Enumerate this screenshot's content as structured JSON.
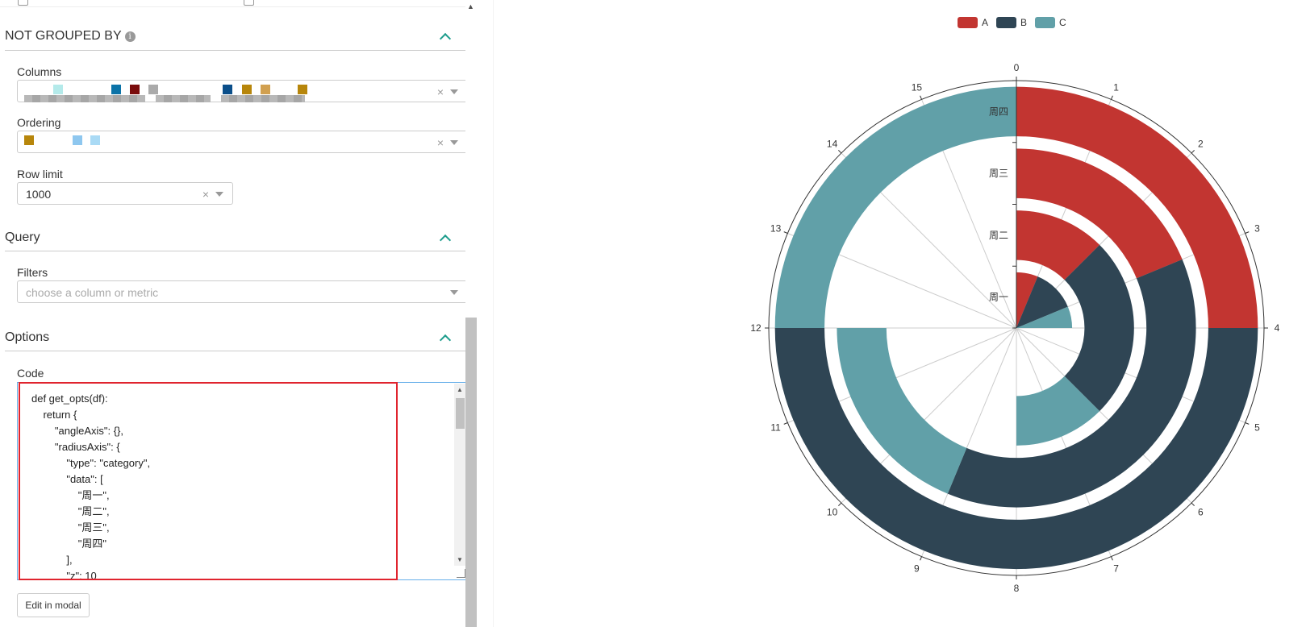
{
  "sections": {
    "not_grouped_by": {
      "title": "NOT GROUPED BY",
      "info_icon": "info-icon"
    },
    "columns": {
      "label": "Columns"
    },
    "ordering": {
      "label": "Ordering"
    },
    "row_limit": {
      "label": "Row limit",
      "value": "1000"
    },
    "query": {
      "title": "Query"
    },
    "filters": {
      "label": "Filters",
      "placeholder": "choose a column or metric"
    },
    "options": {
      "title": "Options"
    },
    "code": {
      "label": "Code",
      "text": "def get_opts(df):\n    return {\n        \"angleAxis\": {},\n        \"radiusAxis\": {\n            \"type\": \"category\",\n            \"data\": [\n                \"周一\",\n                \"周二\",\n                \"周三\",\n                \"周四\"\n            ],\n            \"z\": 10"
    },
    "edit_modal_label": "Edit in modal"
  },
  "icons": {
    "clear": "×",
    "collapse": "chevron-up-icon"
  },
  "colors": {
    "accent": "#1f9d8d",
    "highlight": "#e0242e",
    "A": "#c23531",
    "B": "#2f4554",
    "C": "#61a0a8"
  },
  "chart_data": {
    "type": "polar-bar",
    "legend": [
      "A",
      "B",
      "C"
    ],
    "legend_position": "top-center",
    "angle_ticks": [
      "0",
      "1",
      "2",
      "3",
      "4",
      "5",
      "6",
      "7",
      "8",
      "9",
      "10",
      "11",
      "12",
      "13",
      "14",
      "15"
    ],
    "angle_max": 16,
    "radius_categories": [
      "周一",
      "周二",
      "周三",
      "周四"
    ],
    "series": [
      {
        "name": "A",
        "values": [
          1,
          2,
          3,
          4
        ]
      },
      {
        "name": "B",
        "values": [
          2,
          4,
          6,
          8
        ]
      },
      {
        "name": "C",
        "values": [
          1,
          2,
          3,
          4
        ]
      }
    ],
    "stacked": true
  }
}
